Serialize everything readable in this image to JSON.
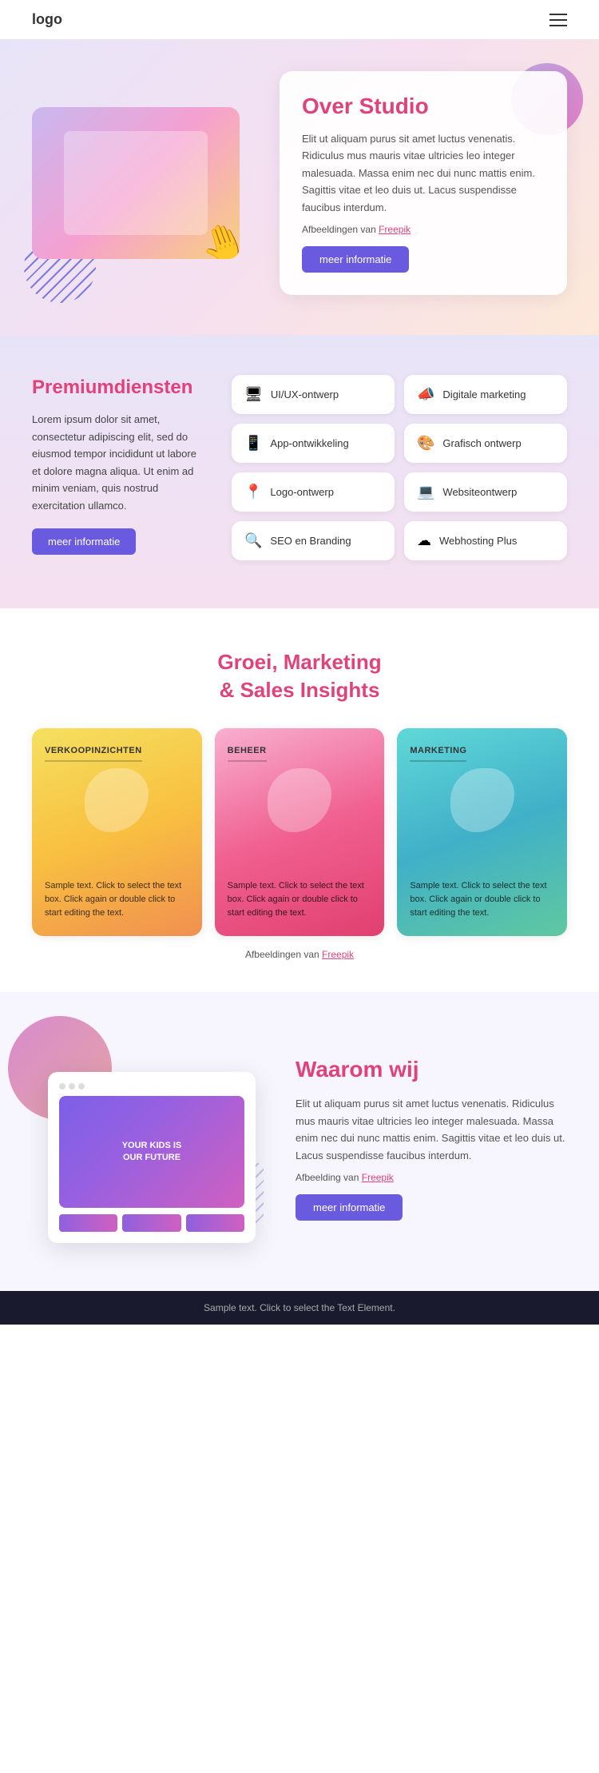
{
  "header": {
    "logo": "logo"
  },
  "hero": {
    "title": "Over Studio",
    "description": "Elit ut aliquam purus sit amet luctus venenatis. Ridiculus mus mauris vitae ultricies leo integer malesuada. Massa enim nec dui nunc mattis enim. Sagittis vitae et leo duis ut. Lacus suspendisse faucibus interdum.",
    "freepik_label": "Afbeeldingen van",
    "freepik_link": "Freepik",
    "btn_label": "meer informatie"
  },
  "services": {
    "title": "Premiumdiensten",
    "description": "Lorem ipsum dolor sit amet, consectetur adipiscing elit, sed do eiusmod tempor incididunt ut labore et dolore magna aliqua. Ut enim ad minim veniam, quis nostrud exercitation ullamco.",
    "btn_label": "meer informatie",
    "items": [
      {
        "icon": "🖥",
        "label": "UI/UX-ontwerp"
      },
      {
        "icon": "📣",
        "label": "Digitale marketing"
      },
      {
        "icon": "📱",
        "label": "App-ontwikkeling"
      },
      {
        "icon": "🎨",
        "label": "Grafisch ontwerp"
      },
      {
        "icon": "📍",
        "label": "Logo-ontwerp"
      },
      {
        "icon": "💻",
        "label": "Websiteontwerp"
      },
      {
        "icon": "🔍",
        "label": "SEO en Branding"
      },
      {
        "icon": "☁",
        "label": "Webhosting Plus"
      }
    ]
  },
  "insights": {
    "title": "Groei, Marketing\n& Sales Insights",
    "cards": [
      {
        "label": "VERKOOPINZICHTEN",
        "type": "yellow",
        "text": "Sample text. Click to select the text box. Click again or double click to start editing the text."
      },
      {
        "label": "BEHEER",
        "type": "pink",
        "text": "Sample text. Click to select the text box. Click again or double click to start editing the text."
      },
      {
        "label": "MARKETING",
        "type": "teal",
        "text": "Sample text. Click to select the text box. Click again or double click to start editing the text."
      }
    ],
    "freepik_label": "Afbeeldingen van",
    "freepik_link": "Freepik"
  },
  "whyus": {
    "title": "Waarom wij",
    "description": "Elit ut aliquam purus sit amet luctus venenatis. Ridiculus mus mauris vitae ultricies leo integer malesuada. Massa enim nec dui nunc mattis enim. Sagittis vitae et leo duis ut. Lacus suspendisse faucibus interdum.",
    "freepik_label": "Afbeelding van",
    "freepik_link": "Freepik",
    "btn_label": "meer informatie",
    "mockup_text": "YOUR KIDS IS\nOUR FUTURE"
  },
  "footer": {
    "text": "Sample text. Click to select the Text Element."
  }
}
